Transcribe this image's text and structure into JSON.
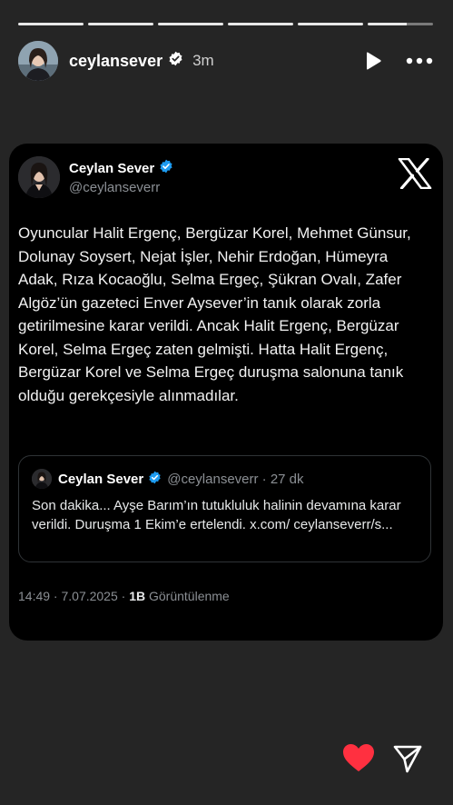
{
  "progress": {
    "segments": 6,
    "current_index": 5,
    "current_fraction": 0.6
  },
  "story": {
    "username": "ceylansever",
    "time": "3m"
  },
  "tweet": {
    "name": "Ceylan Sever",
    "handle": "@ceylanseverr",
    "text": "Oyuncular Halit Ergenç, Bergüzar Korel, Mehmet Günsur, Dolunay Soysert, Nejat İşler, Nehir Erdoğan, Hümeyra Adak, Rıza Kocaoğlu, Selma Ergeç, Şükran Ovalı, Zafer Algöz’ün gazeteci Enver Aysever’in tanık olarak zorla getirilmesine karar verildi. Ancak Halit Ergenç, Bergüzar Korel, Selma Ergeç zaten gelmişti. Hatta Halit Ergenç, Bergüzar Korel ve Selma Ergeç duruşma salonuna tanık olduğu gerekçesiyle alınmadılar.",
    "quote": {
      "name": "Ceylan Sever",
      "meta": "@ceylanseverr · 27 dk",
      "text": "Son dakika... Ayşe Barım’ın tutukluluk halinin devamına karar verildi. Duruşma 1 Ekim’e ertelendi. x.com/ ceylanseverr/s..."
    },
    "footer": {
      "datetime": "14:49 · 7.07.2025 · ",
      "views_count": "1B",
      "views_label": " Görüntülenme"
    }
  },
  "colors": {
    "like": "#ff3040",
    "verified": "#1d9bf0",
    "background": "#252525",
    "card": "#000000"
  },
  "icons": [
    "verified-badge-icon",
    "play-icon",
    "more-icon",
    "x-logo-icon",
    "heart-icon",
    "send-icon"
  ]
}
